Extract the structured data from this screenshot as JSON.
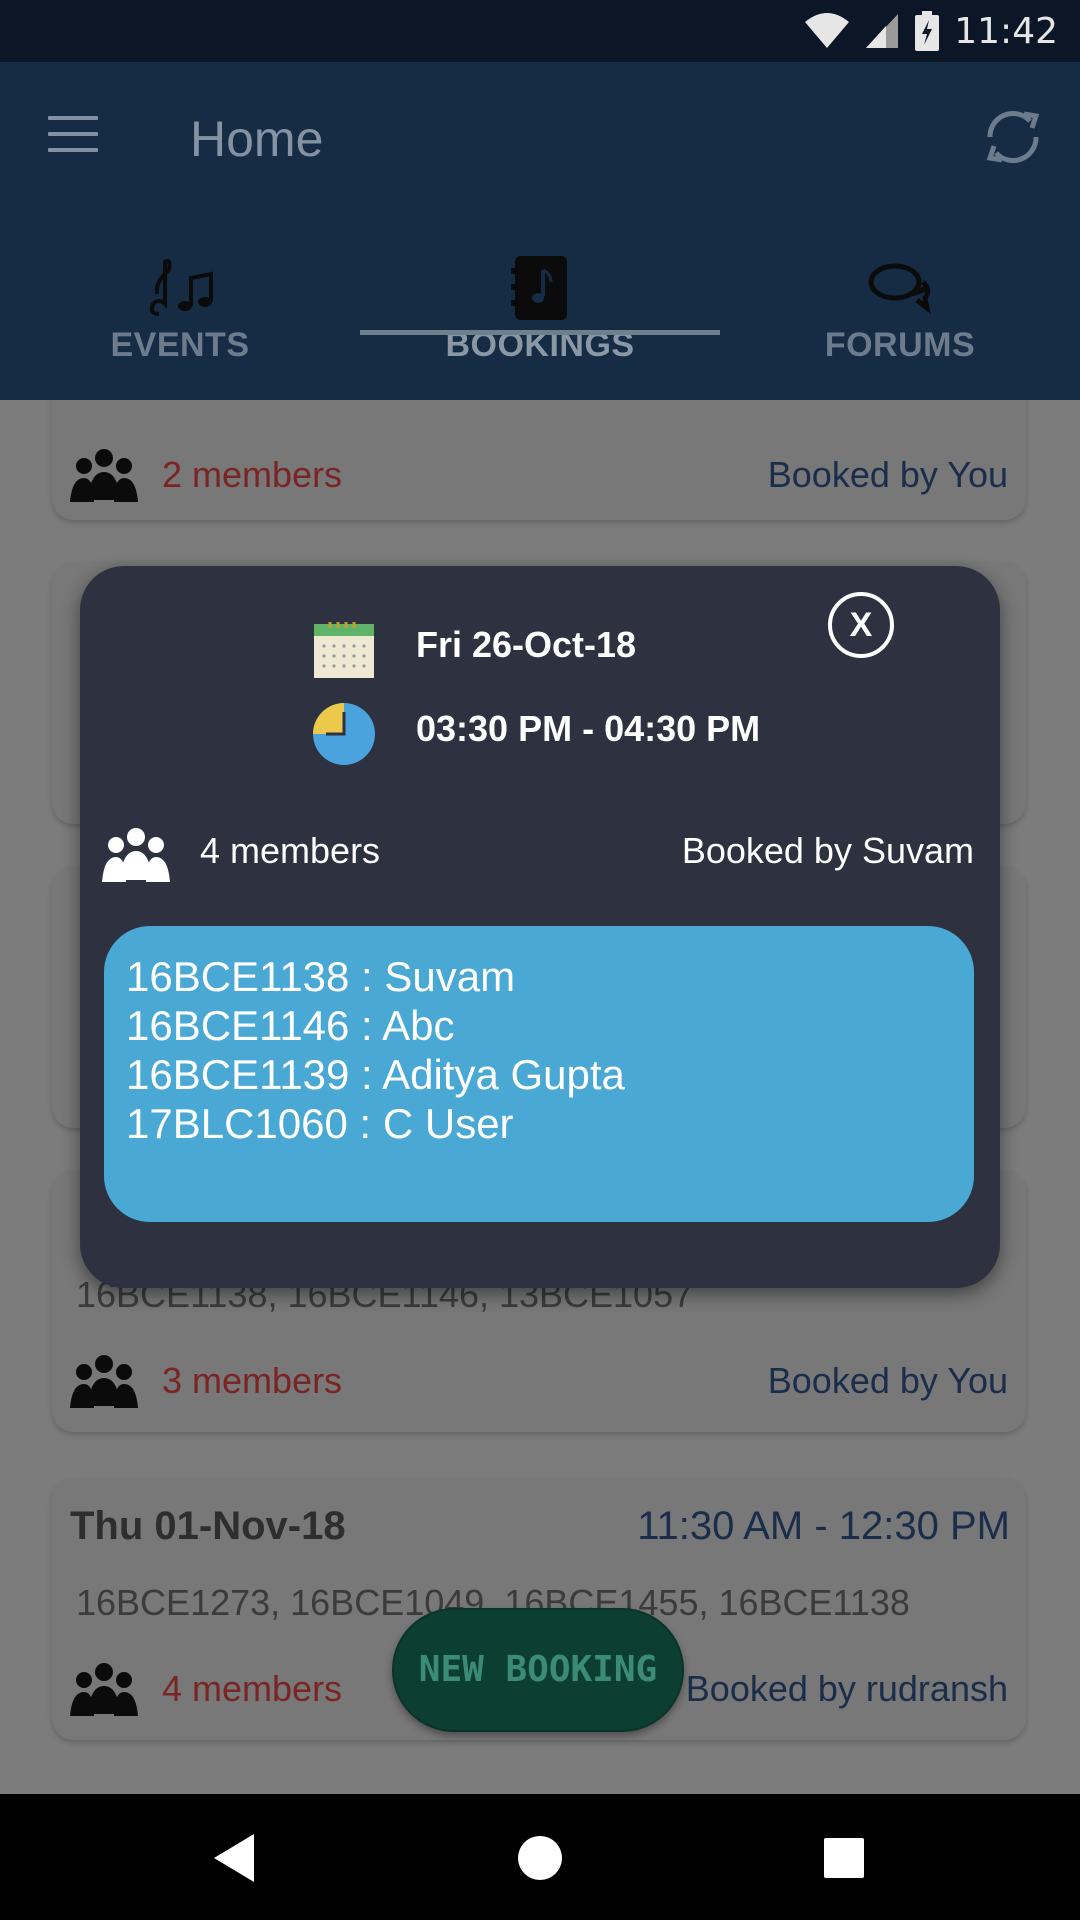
{
  "status_bar": {
    "time": "11:42",
    "icons": [
      "wifi-icon",
      "signal-icon",
      "battery-charging-icon"
    ]
  },
  "app_bar": {
    "title": "Home",
    "menu_icon": "menu-icon",
    "refresh_icon": "refresh-icon"
  },
  "tabs": [
    {
      "label": "EVENTS",
      "icon": "music-notes-icon",
      "active": false
    },
    {
      "label": "BOOKINGS",
      "icon": "music-book-icon",
      "active": true
    },
    {
      "label": "FORUMS",
      "icon": "chat-bubbles-icon",
      "active": false
    }
  ],
  "bookings": [
    {
      "date": "",
      "time": "",
      "ids": "",
      "members": "2 members",
      "booked_by": "Booked by You"
    },
    {
      "date": "Fri 26-Oct-18",
      "time": "",
      "ids": "",
      "members": "",
      "booked_by": ""
    },
    {
      "date": "",
      "time": "",
      "ids": "",
      "members": "",
      "booked_by": ""
    },
    {
      "date": "",
      "time": "",
      "ids": "16BCE1138, 16BCE1146, 13BCE1057",
      "members": "3 members",
      "booked_by": "Booked by You"
    },
    {
      "date": "Thu 01-Nov-18",
      "time": "11:30 AM - 12:30 PM",
      "ids": "16BCE1273, 16BCE1049, 16BCE1455, 16BCE1138",
      "members": "4 members",
      "booked_by": "Booked by rudransh"
    }
  ],
  "fab": {
    "label": "NEW BOOKING"
  },
  "modal": {
    "date": "Fri 26-Oct-18",
    "time": "03:30 PM - 04:30 PM",
    "members": "4 members",
    "booked_by": "Booked by Suvam",
    "close_label": "X",
    "member_list": [
      "16BCE1138 : Suvam",
      "16BCE1146 : Abc",
      "16BCE1139 : Aditya Gupta",
      "17BLC1060 : C User"
    ]
  },
  "colors": {
    "app_bar": "#152c44",
    "modal": "#2e3140",
    "member_list_bg": "#4aa9d4",
    "fab": "#0c3f32"
  }
}
